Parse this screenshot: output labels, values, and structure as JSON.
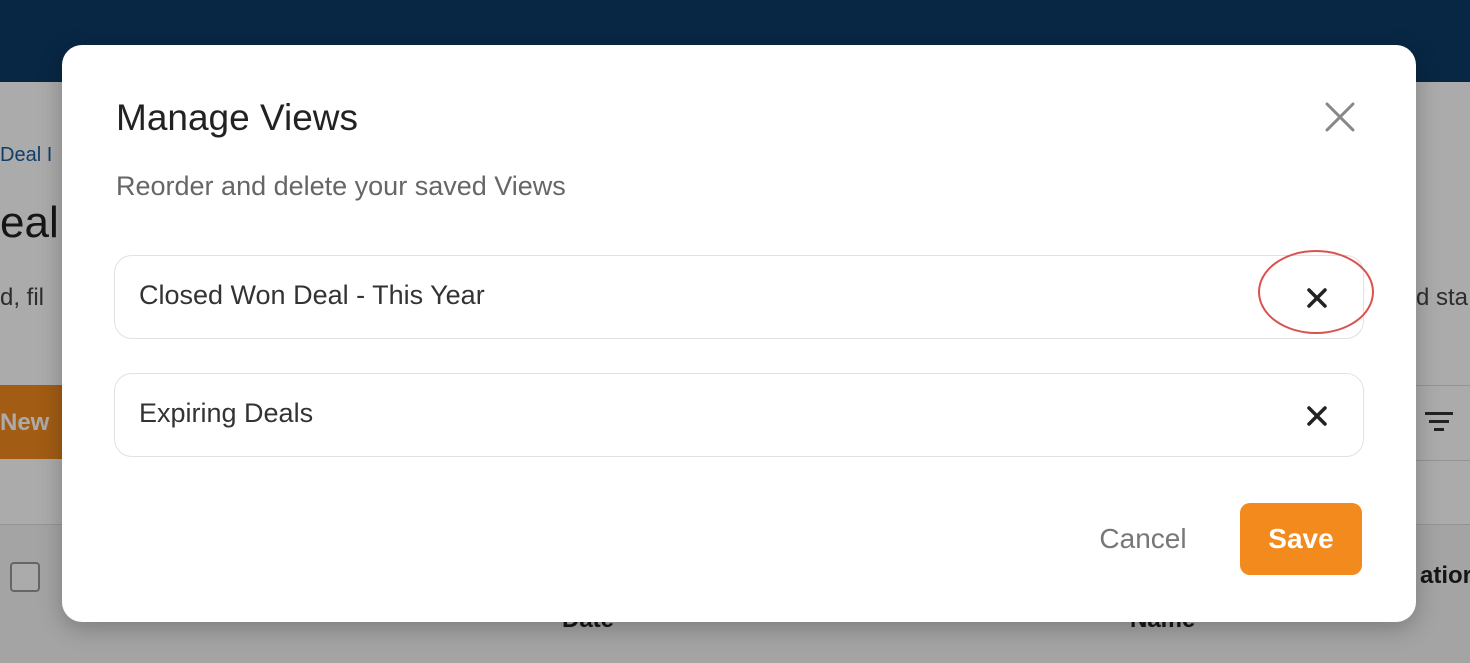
{
  "background": {
    "breadcrumb": "Deal I",
    "title": "eal",
    "description_left": "d, fil",
    "description_right": "d sta",
    "new_button_label": "New",
    "columns": [
      {
        "label": "Date"
      },
      {
        "label": "Name"
      },
      {
        "label": "atior"
      }
    ]
  },
  "modal": {
    "title": "Manage Views",
    "subtitle": "Reorder and delete your saved Views",
    "views": [
      {
        "label": "Closed Won Deal - This Year",
        "highlighted": true
      },
      {
        "label": "Expiring Deals",
        "highlighted": false
      }
    ],
    "cancel_label": "Cancel",
    "save_label": "Save"
  },
  "colors": {
    "topbar": "#0d3b66",
    "accent": "#f28a1e",
    "highlight": "#d9534f"
  },
  "icons": {
    "close": "close-icon",
    "delete": "x-icon",
    "filter": "filter-icon"
  }
}
